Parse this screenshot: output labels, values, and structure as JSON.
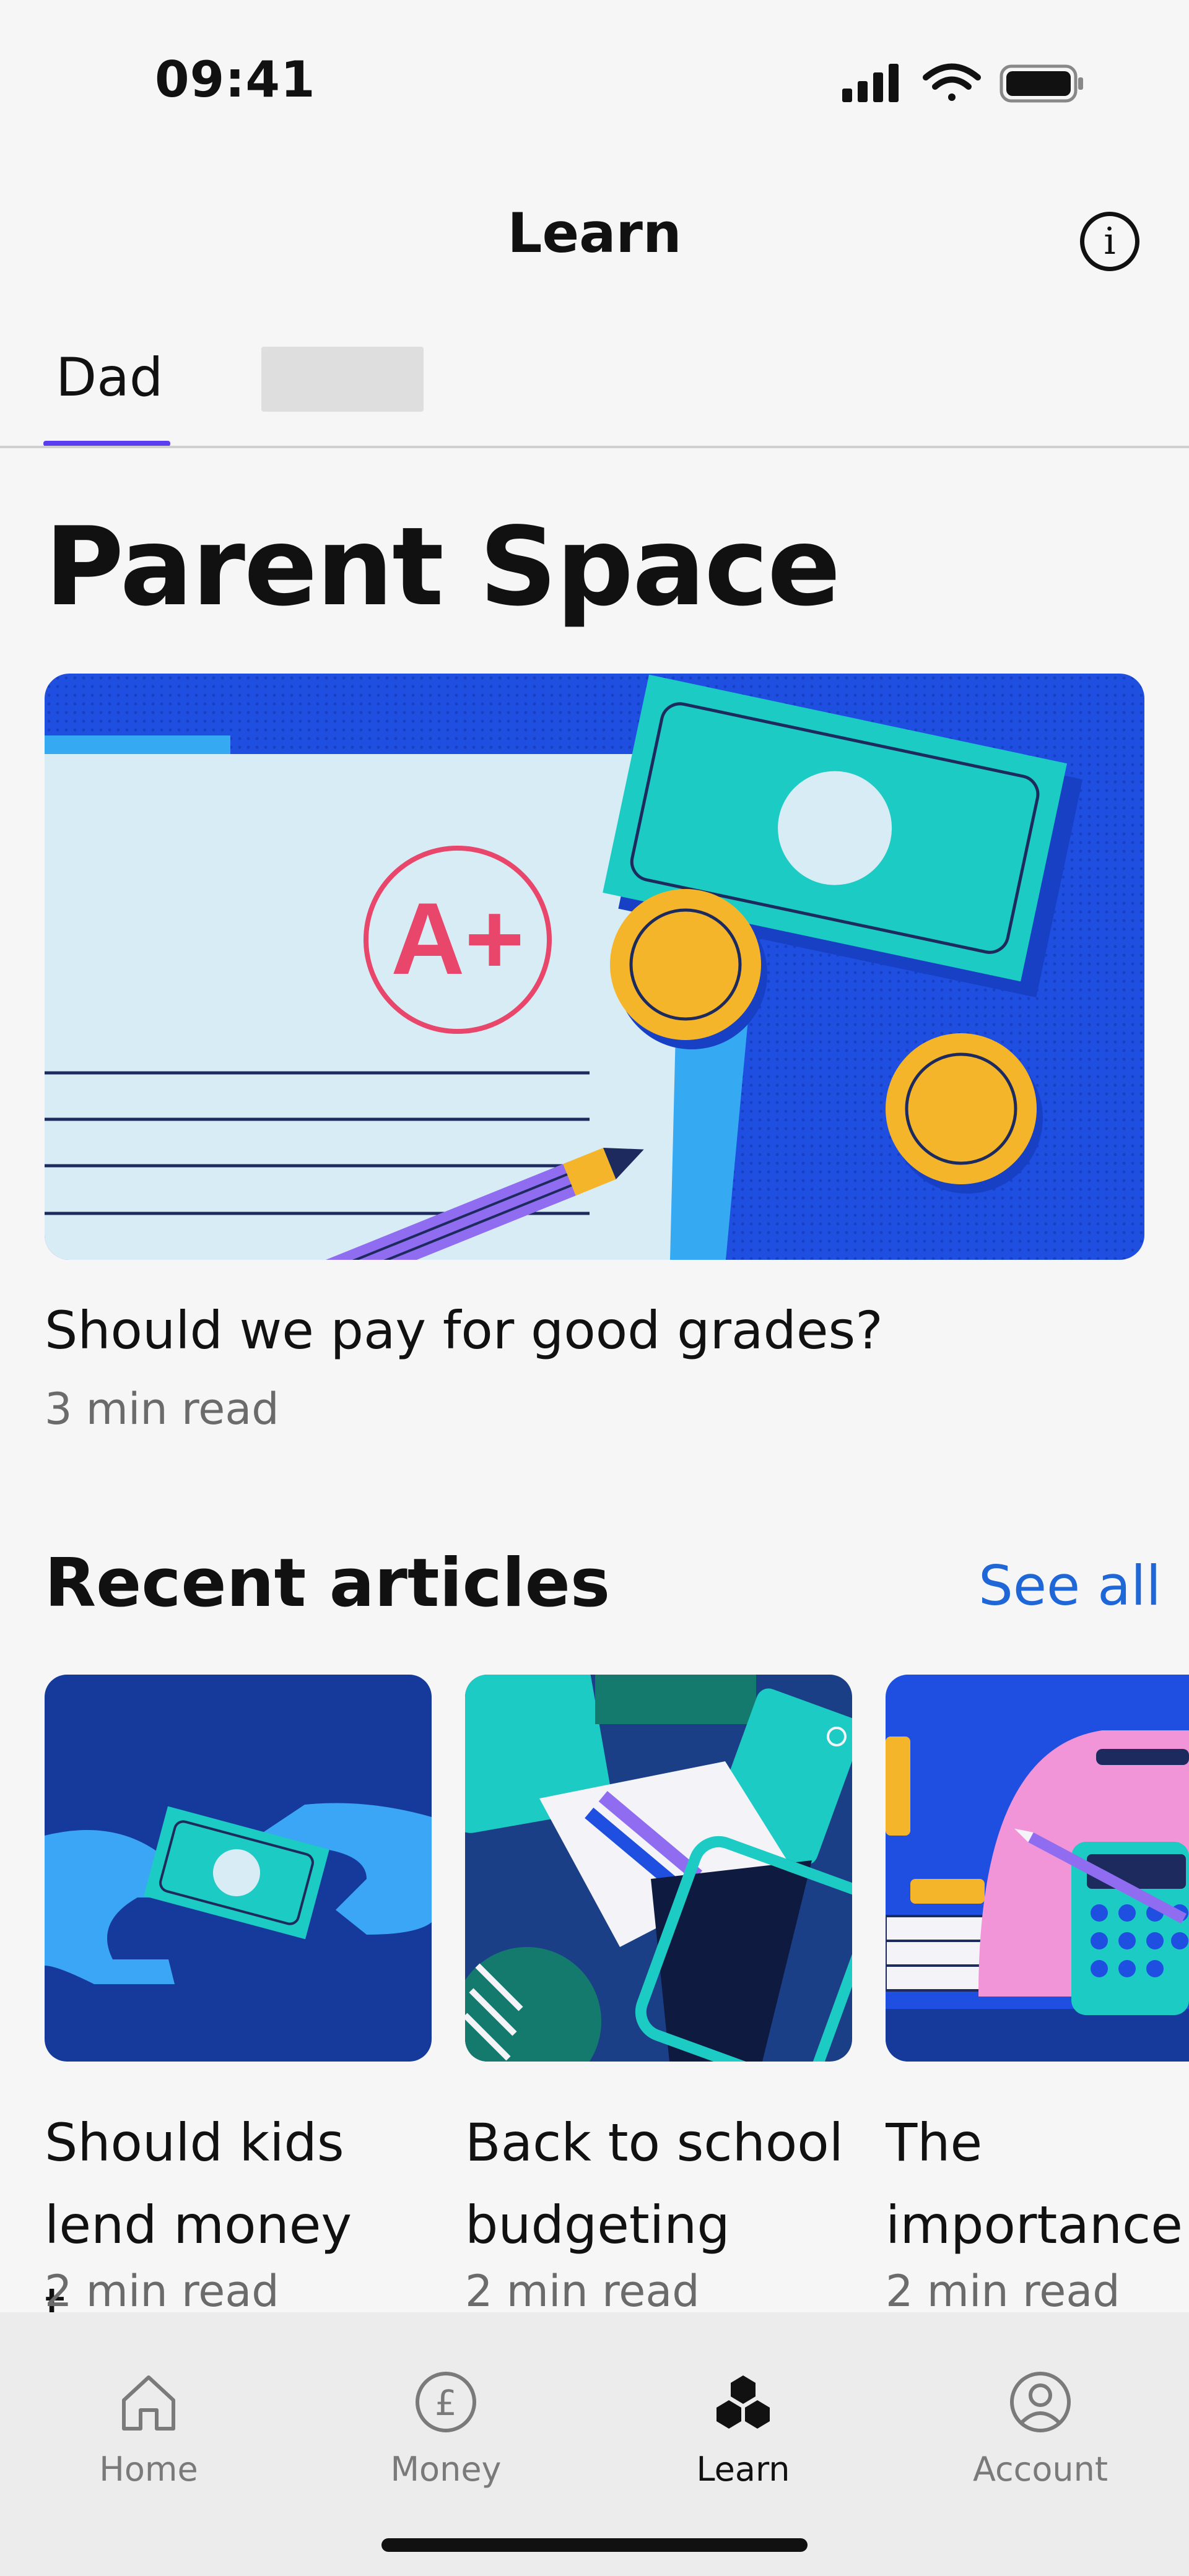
{
  "status_bar": {
    "time": "09:41"
  },
  "header": {
    "title": "Learn"
  },
  "tabs": {
    "items": [
      {
        "label": "Dad"
      },
      {
        "label": ""
      }
    ]
  },
  "hero": {
    "section_title": "Parent Space",
    "article_title": "Should we pay for good grades?",
    "article_meta": "3 min read",
    "illustration_text": "A+"
  },
  "recent": {
    "title": "Recent articles",
    "see_all_label": "See all",
    "articles": [
      {
        "title": "Should kids lend money t...",
        "meta": "2 min read"
      },
      {
        "title": "Back to school budgeting",
        "meta": "2 min read"
      },
      {
        "title": "The importance",
        "meta": "2 min read"
      }
    ]
  },
  "bottom_nav": {
    "items": [
      {
        "label": "Home",
        "icon": "home-icon"
      },
      {
        "label": "Money",
        "icon": "pound-icon"
      },
      {
        "label": "Learn",
        "icon": "learn-cubes-icon"
      },
      {
        "label": "Account",
        "icon": "account-icon"
      }
    ],
    "active": "Learn"
  },
  "colors": {
    "accent": "#5a3df0",
    "link": "#1f66d6",
    "illustration_blue": "#1f4fe0",
    "illustration_teal": "#1ccbc3",
    "illustration_gold": "#f5b52a"
  }
}
